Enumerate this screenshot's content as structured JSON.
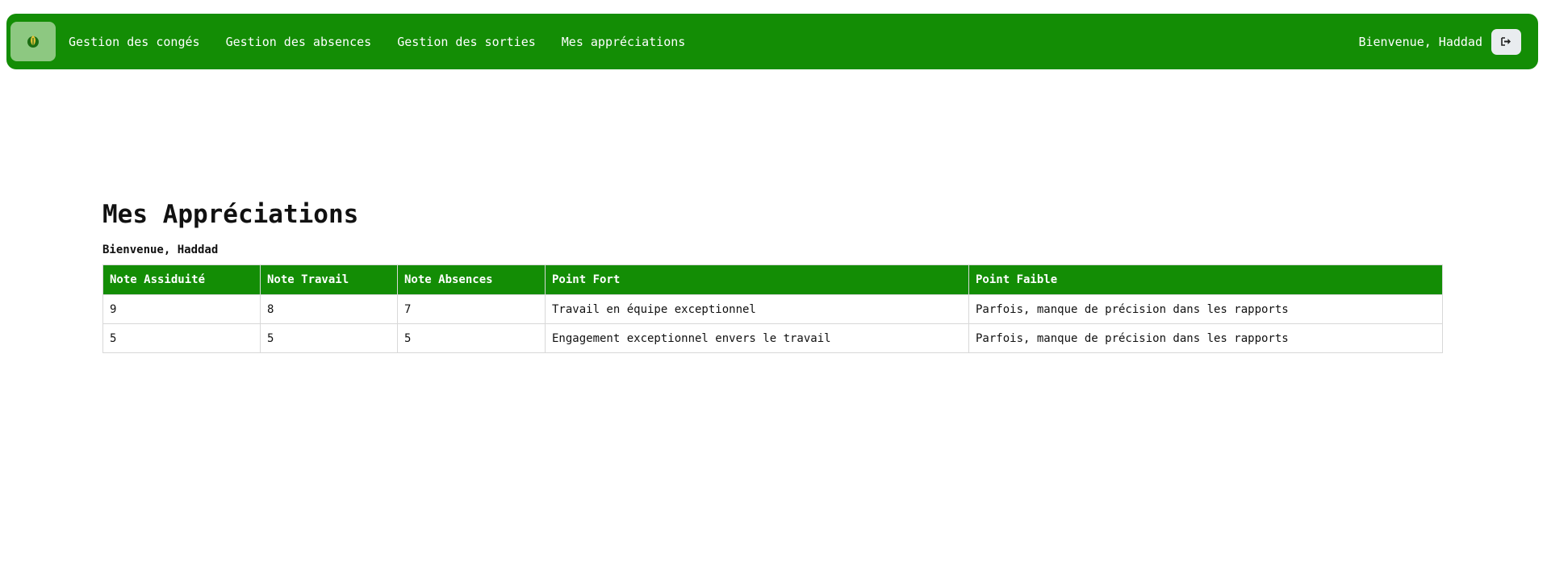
{
  "navbar": {
    "brand_icon": "leaf-logo-icon",
    "links": [
      {
        "label": "Gestion des congés"
      },
      {
        "label": "Gestion des absences"
      },
      {
        "label": "Gestion des sorties"
      },
      {
        "label": "Mes appréciations"
      }
    ],
    "welcome": "Bienvenue, Haddad",
    "logout_icon": "sign-out-icon"
  },
  "main": {
    "title": "Mes Appréciations",
    "welcome": "Bienvenue, Haddad"
  },
  "table": {
    "headers": [
      "Note Assiduité",
      "Note Travail",
      "Note Absences",
      "Point Fort",
      "Point Faible"
    ],
    "rows": [
      [
        "9",
        "8",
        "7",
        "Travail en équipe exceptionnel",
        "Parfois, manque de précision dans les rapports"
      ],
      [
        "5",
        "5",
        "5",
        "Engagement exceptionnel envers le travail",
        "Parfois, manque de précision dans les rapports"
      ]
    ]
  },
  "colors": {
    "primary": "#138d05",
    "brand_bg": "#8dc881",
    "logout_bg": "#e9ecef",
    "border": "#d8d8d8"
  }
}
